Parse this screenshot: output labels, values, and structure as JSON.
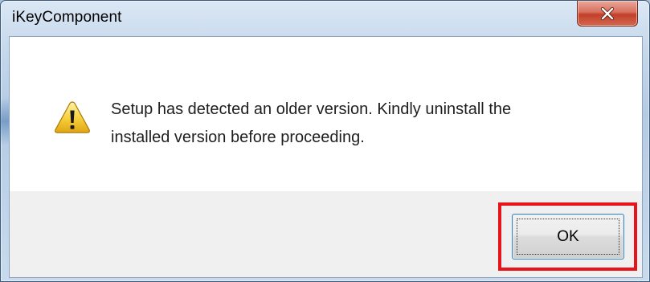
{
  "window": {
    "title": "iKeyComponent"
  },
  "dialog": {
    "icon": "warning-icon",
    "message": "Setup has detected an older version. Kindly uninstall the\ninstalled version before proceeding."
  },
  "buttons": {
    "ok_label": "OK",
    "close_glyph": "x"
  },
  "highlight": {
    "color": "#e8141c",
    "target": "ok-button"
  }
}
